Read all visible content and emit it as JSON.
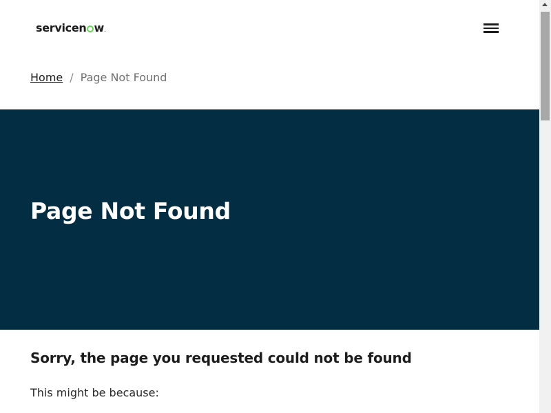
{
  "header": {
    "logo_text_left": "servicen",
    "logo_text_right": "w",
    "logo_mark": "o-ring-green",
    "logo_trademark": ".",
    "menu_icon": "hamburger-menu-icon"
  },
  "breadcrumb": {
    "home_label": "Home",
    "separator": "/",
    "current_label": "Page Not Found"
  },
  "hero": {
    "title": "Page Not Found",
    "background_color": "#032d42"
  },
  "content": {
    "heading": "Sorry, the page you requested could not be found",
    "text": "This might be because:"
  },
  "colors": {
    "brand_accent": "#62d84e",
    "hero_background": "#032d42",
    "text_primary": "#1d1d1d"
  }
}
